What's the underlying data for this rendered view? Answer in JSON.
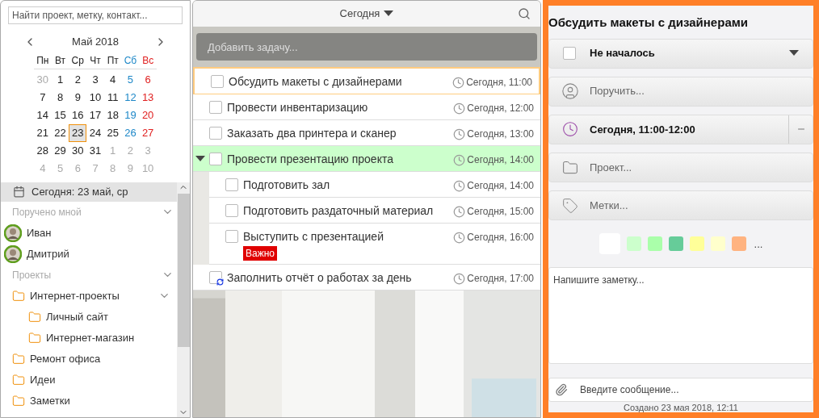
{
  "sidebar": {
    "search": {
      "placeholder": "Найти проект, метку, контакт..."
    },
    "calendar": {
      "month": "Май 2018",
      "weekdays": [
        "Пн",
        "Вт",
        "Ср",
        "Чт",
        "Пт",
        "Сб",
        "Вс"
      ],
      "weeks": [
        [
          {
            "d": "30",
            "muted": true,
            "selected": false
          },
          {
            "d": "1",
            "muted": false,
            "selected": false
          },
          {
            "d": "2",
            "muted": false,
            "selected": false
          },
          {
            "d": "3",
            "muted": false,
            "selected": false
          },
          {
            "d": "4",
            "muted": false,
            "selected": false
          },
          {
            "d": "5",
            "muted": false,
            "selected": false
          },
          {
            "d": "6",
            "muted": false,
            "selected": false
          }
        ],
        [
          {
            "d": "7",
            "muted": false,
            "selected": false
          },
          {
            "d": "8",
            "muted": false,
            "selected": false
          },
          {
            "d": "9",
            "muted": false,
            "selected": false
          },
          {
            "d": "10",
            "muted": false,
            "selected": false
          },
          {
            "d": "11",
            "muted": false,
            "selected": false
          },
          {
            "d": "12",
            "muted": false,
            "selected": false
          },
          {
            "d": "13",
            "muted": false,
            "selected": false
          }
        ],
        [
          {
            "d": "14",
            "muted": false,
            "selected": false
          },
          {
            "d": "15",
            "muted": false,
            "selected": false
          },
          {
            "d": "16",
            "muted": false,
            "selected": false
          },
          {
            "d": "17",
            "muted": false,
            "selected": false
          },
          {
            "d": "18",
            "muted": false,
            "selected": false
          },
          {
            "d": "19",
            "muted": false,
            "selected": false
          },
          {
            "d": "20",
            "muted": false,
            "selected": false
          }
        ],
        [
          {
            "d": "21",
            "muted": false,
            "selected": false
          },
          {
            "d": "22",
            "muted": false,
            "selected": false
          },
          {
            "d": "23",
            "muted": false,
            "selected": true
          },
          {
            "d": "24",
            "muted": false,
            "selected": false
          },
          {
            "d": "25",
            "muted": false,
            "selected": false
          },
          {
            "d": "26",
            "muted": false,
            "selected": false
          },
          {
            "d": "27",
            "muted": false,
            "selected": false
          }
        ],
        [
          {
            "d": "28",
            "muted": false,
            "selected": false
          },
          {
            "d": "29",
            "muted": false,
            "selected": false
          },
          {
            "d": "30",
            "muted": false,
            "selected": false
          },
          {
            "d": "31",
            "muted": false,
            "selected": false
          },
          {
            "d": "1",
            "muted": true,
            "selected": false
          },
          {
            "d": "2",
            "muted": true,
            "selected": false
          },
          {
            "d": "3",
            "muted": true,
            "selected": false
          }
        ],
        [
          {
            "d": "4",
            "muted": true,
            "selected": false
          },
          {
            "d": "5",
            "muted": true,
            "selected": false
          },
          {
            "d": "6",
            "muted": true,
            "selected": false
          },
          {
            "d": "7",
            "muted": true,
            "selected": false
          },
          {
            "d": "8",
            "muted": true,
            "selected": false
          },
          {
            "d": "9",
            "muted": true,
            "selected": false
          },
          {
            "d": "10",
            "muted": true,
            "selected": false
          }
        ]
      ]
    },
    "today": {
      "label": "Сегодня: 23 май, ср",
      "selected": true
    },
    "sections": [
      {
        "title": "Поручено мной",
        "expanded": true,
        "items": [
          {
            "kind": "person",
            "label": "Иван"
          },
          {
            "kind": "person",
            "label": "Дмитрий"
          }
        ]
      },
      {
        "title": "Проекты",
        "expanded": true,
        "items": [
          {
            "kind": "folder",
            "label": "Интернет-проекты",
            "expanded": true,
            "children": [
              {
                "kind": "folder",
                "label": "Личный сайт"
              },
              {
                "kind": "folder",
                "label": "Интернет-магазин"
              }
            ]
          },
          {
            "kind": "folder",
            "label": "Ремонт офиса"
          },
          {
            "kind": "folder",
            "label": "Идеи"
          },
          {
            "kind": "folder",
            "label": "Заметки"
          }
        ]
      }
    ]
  },
  "tasks": {
    "filter": "Сегодня",
    "add_placeholder": "Добавить задачу...",
    "items": [
      {
        "title": "Обсудить макеты с дизайнерами",
        "time": "Сегодня, 11:00",
        "checked": false,
        "selected": true,
        "color": "#ffffff"
      },
      {
        "title": "Провести инвентаризацию",
        "time": "Сегодня, 12:00",
        "checked": false,
        "selected": false,
        "color": "#ffffff"
      },
      {
        "title": "Заказать два принтера и сканер",
        "time": "Сегодня, 13:00",
        "checked": false,
        "selected": false,
        "color": "#ffffff"
      },
      {
        "title": "Провести презентацию проекта",
        "time": "Сегодня, 14:00",
        "checked": false,
        "selected": false,
        "color": "#ccffcc",
        "expanded": true,
        "children": [
          {
            "title": "Подготовить зал",
            "time": "Сегодня, 14:00",
            "checked": false,
            "selected": false,
            "color": "#ffffff"
          },
          {
            "title": "Подготовить раздаточный материал",
            "time": "Сегодня, 15:00",
            "checked": false,
            "selected": false,
            "color": "#ffffff"
          },
          {
            "title": "Выступить с презентацией",
            "time": "Сегодня, 16:00",
            "checked": false,
            "selected": false,
            "color": "#ffffff",
            "tag": "Важно"
          }
        ]
      },
      {
        "title": "Заполнить отчёт о работах за день",
        "time": "Сегодня, 17:00",
        "checked": false,
        "selected": false,
        "color": "#ffffff",
        "recurring": true
      }
    ]
  },
  "details": {
    "title": "Обсудить макеты с дизайнерами",
    "status": {
      "label": "Не началось",
      "checked": false
    },
    "fields": [
      {
        "kind": "person",
        "placeholder": "Поручить..."
      },
      {
        "kind": "time",
        "value": "Сегодня, 11:00-12:00"
      },
      {
        "kind": "project",
        "placeholder": "Проект..."
      },
      {
        "kind": "tags",
        "placeholder": "Метки..."
      }
    ],
    "colors": [
      {
        "color": "#ffffff",
        "selected": true
      },
      {
        "color": "#ccffcc",
        "selected": false
      },
      {
        "color": "#aaffaa",
        "selected": false
      },
      {
        "color": "#66cc99",
        "selected": false
      },
      {
        "color": "#ffff99",
        "selected": false
      },
      {
        "color": "#ffffcc",
        "selected": false
      },
      {
        "color": "#ffb380",
        "selected": false
      }
    ],
    "more": "...",
    "note_placeholder": "Напишите заметку...",
    "message_placeholder": "Введите сообщение...",
    "created": "Создано 23 мая 2018, 12:11"
  }
}
